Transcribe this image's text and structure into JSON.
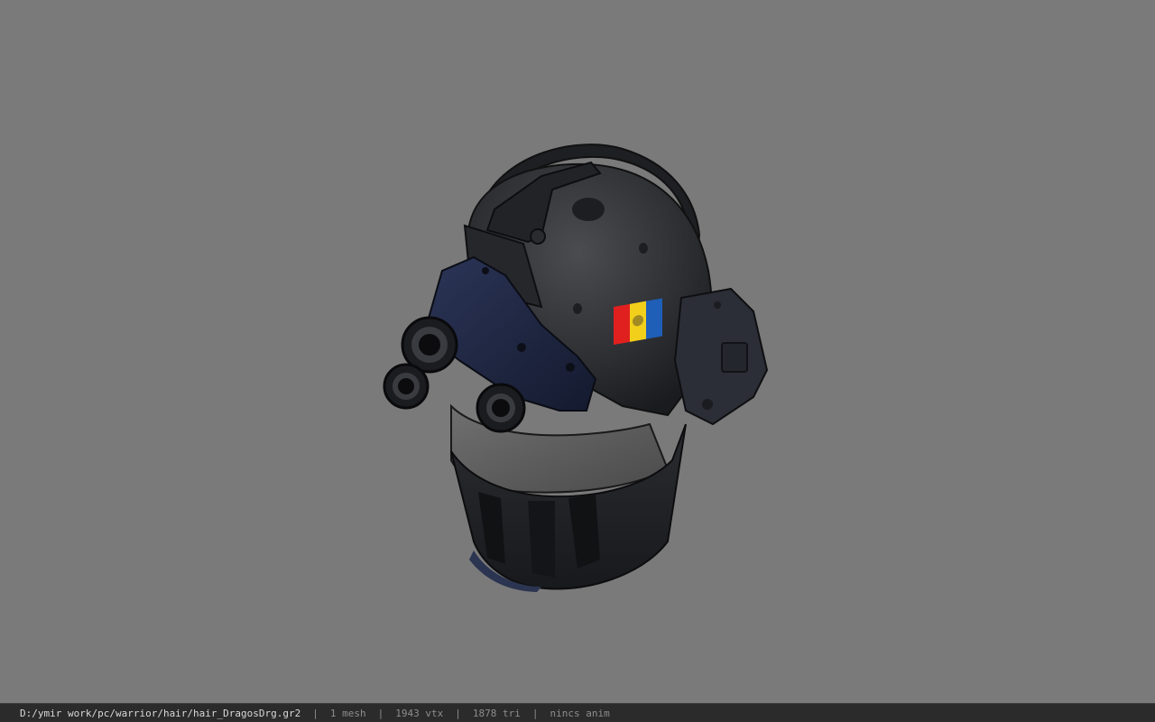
{
  "viewer": {
    "background_color": "#7a7a7a",
    "model_subject": "tactical helmet with night-vision goggles and tricolor flag patch",
    "flag_colors": [
      "#e0201f",
      "#f2cf1a",
      "#1f5fb8"
    ]
  },
  "statusbar": {
    "file_path": "D:/ymir work/pc/warrior/hair/hair_DragosDrg.gr2",
    "mesh_count": "1 mesh",
    "vertex_count": "1943 vtx",
    "triangle_count": "1878 tri",
    "anim_status": "nincs anim",
    "separator": "|"
  }
}
